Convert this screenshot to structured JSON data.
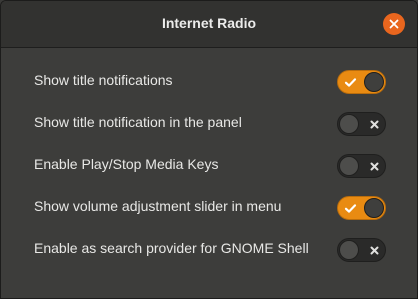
{
  "window": {
    "title": "Internet Radio",
    "close_icon": "close-icon",
    "accent_color": "#e98b12",
    "close_color": "#e9661e"
  },
  "settings": [
    {
      "label": "Show title notifications",
      "enabled": true
    },
    {
      "label": "Show title notification in the panel",
      "enabled": false
    },
    {
      "label": "Enable Play/Stop Media Keys",
      "enabled": false
    },
    {
      "label": "Show volume adjustment slider in menu",
      "enabled": true
    },
    {
      "label": "Enable as search provider for GNOME Shell",
      "enabled": false
    }
  ]
}
